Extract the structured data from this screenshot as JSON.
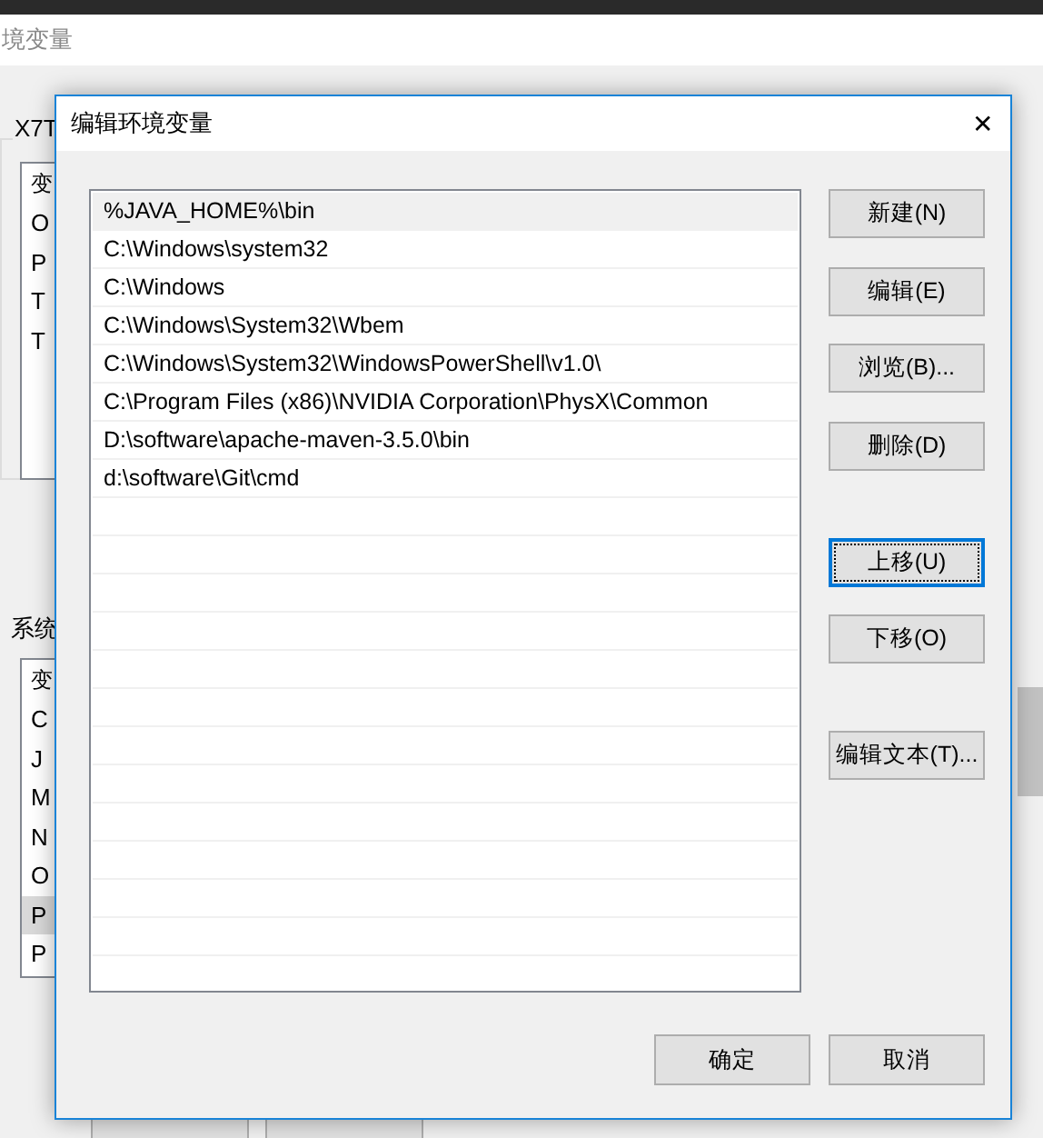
{
  "parent_window": {
    "title": "境变量",
    "user_group": {
      "label": "X7T",
      "header": "变",
      "rows": [
        {
          "text": "O",
          "selected": false
        },
        {
          "text": "P",
          "selected": false
        },
        {
          "text": "T",
          "selected": false
        },
        {
          "text": "T",
          "selected": false
        }
      ]
    },
    "system_group": {
      "label": "系统",
      "header": "变",
      "rows": [
        {
          "text": "C",
          "selected": false
        },
        {
          "text": "J",
          "selected": false
        },
        {
          "text": "M",
          "selected": false
        },
        {
          "text": "N",
          "selected": false
        },
        {
          "text": "O",
          "selected": false
        },
        {
          "text": "P",
          "selected": true
        },
        {
          "text": "P",
          "selected": false
        }
      ]
    }
  },
  "dialog": {
    "title": "编辑环境变量",
    "close": "✕",
    "paths": [
      {
        "text": "%JAVA_HOME%\\bin",
        "selected": true
      },
      {
        "text": "C:\\Windows\\system32",
        "selected": false
      },
      {
        "text": "C:\\Windows",
        "selected": false
      },
      {
        "text": "C:\\Windows\\System32\\Wbem",
        "selected": false
      },
      {
        "text": "C:\\Windows\\System32\\WindowsPowerShell\\v1.0\\",
        "selected": false
      },
      {
        "text": "C:\\Program Files (x86)\\NVIDIA Corporation\\PhysX\\Common",
        "selected": false
      },
      {
        "text": "D:\\software\\apache-maven-3.5.0\\bin",
        "selected": false
      },
      {
        "text": "d:\\software\\Git\\cmd",
        "selected": false
      }
    ],
    "side_buttons": [
      {
        "label": "新建(N)",
        "focused": false
      },
      {
        "label": "编辑(E)",
        "focused": false
      },
      {
        "label": "浏览(B)...",
        "focused": false
      },
      {
        "label": "删除(D)",
        "focused": false
      },
      {
        "label": "上移(U)",
        "focused": true
      },
      {
        "label": "下移(O)",
        "focused": false
      },
      {
        "label": "编辑文本(T)...",
        "focused": false
      }
    ],
    "footer_buttons": [
      "确定",
      "取消"
    ]
  }
}
